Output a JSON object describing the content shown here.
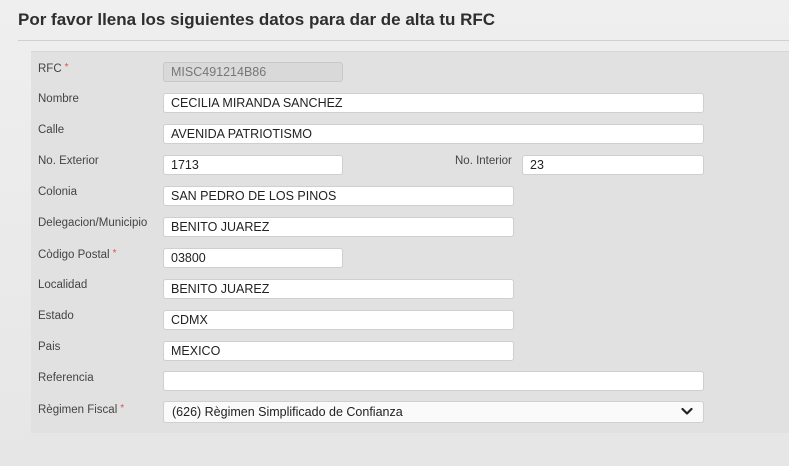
{
  "header": {
    "title": "Por favor llena los siguientes datos para dar de alta tu RFC"
  },
  "form": {
    "rfc": {
      "label": "RFC",
      "required_mark": "*",
      "value": "MISC491214B86"
    },
    "nombre": {
      "label": "Nombre",
      "value": "CECILIA MIRANDA SANCHEZ"
    },
    "calle": {
      "label": "Calle",
      "value": "AVENIDA PATRIOTISMO"
    },
    "no_exterior": {
      "label": "No. Exterior",
      "value": "1713"
    },
    "no_interior": {
      "label": "No. Interior",
      "value": "23"
    },
    "colonia": {
      "label": "Colonia",
      "value": "SAN PEDRO DE LOS PINOS"
    },
    "delegacion": {
      "label": "Delegacion/Municipio",
      "value": "BENITO JUAREZ"
    },
    "codigo_postal": {
      "label": "Còdigo Postal",
      "required_mark": "*",
      "value": "03800"
    },
    "localidad": {
      "label": "Localidad",
      "value": "BENITO JUAREZ"
    },
    "estado": {
      "label": "Estado",
      "value": "CDMX"
    },
    "pais": {
      "label": "Pais",
      "value": "MEXICO"
    },
    "referencia": {
      "label": "Referencia",
      "value": ""
    },
    "regimen": {
      "label": "Règimen Fiscal",
      "required_mark": "*",
      "value": "(626) Règimen Simplificado de Confianza",
      "icon": "chevron-down-icon"
    }
  },
  "colors": {
    "required": "#e05050",
    "panel_bg": "#e1e1e1",
    "field_bg": "#ffffff",
    "disabled_bg": "#d9d9d9"
  }
}
